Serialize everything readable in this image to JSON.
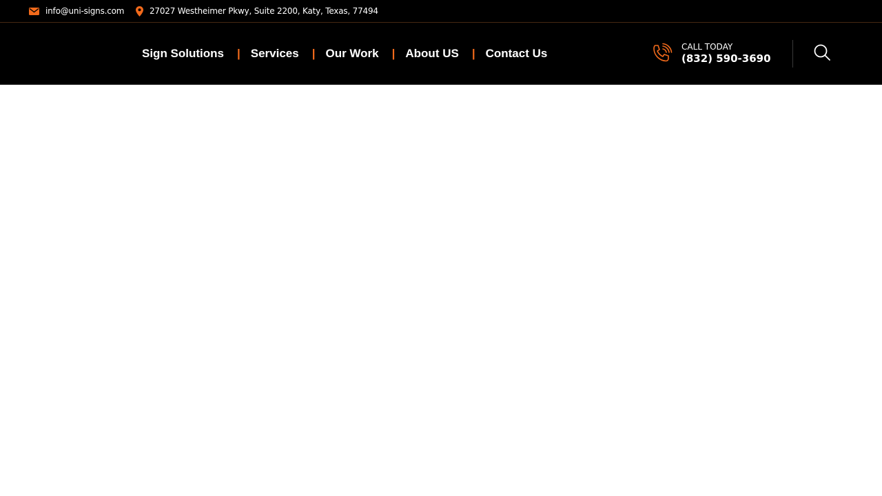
{
  "topbar": {
    "email": "info@uni-signs.com",
    "address": "27027 Westheimer Pkwy, Suite 2200, Katy, Texas, 77494",
    "icons": {
      "email": "envelope-icon",
      "address": "map-pin-icon"
    }
  },
  "nav": {
    "items": [
      {
        "label": "Sign Solutions"
      },
      {
        "label": "Services"
      },
      {
        "label": "Our Work"
      },
      {
        "label": "About US"
      },
      {
        "label": "Contact Us"
      }
    ],
    "separator": "|"
  },
  "call": {
    "label": "CALL TODAY",
    "number": "(832) 590-3690",
    "icon": "phone-ringing-icon"
  },
  "search": {
    "icon": "search-icon"
  },
  "colors": {
    "accent": "#f26a1b",
    "header_bg": "#000000",
    "text": "#ffffff"
  }
}
